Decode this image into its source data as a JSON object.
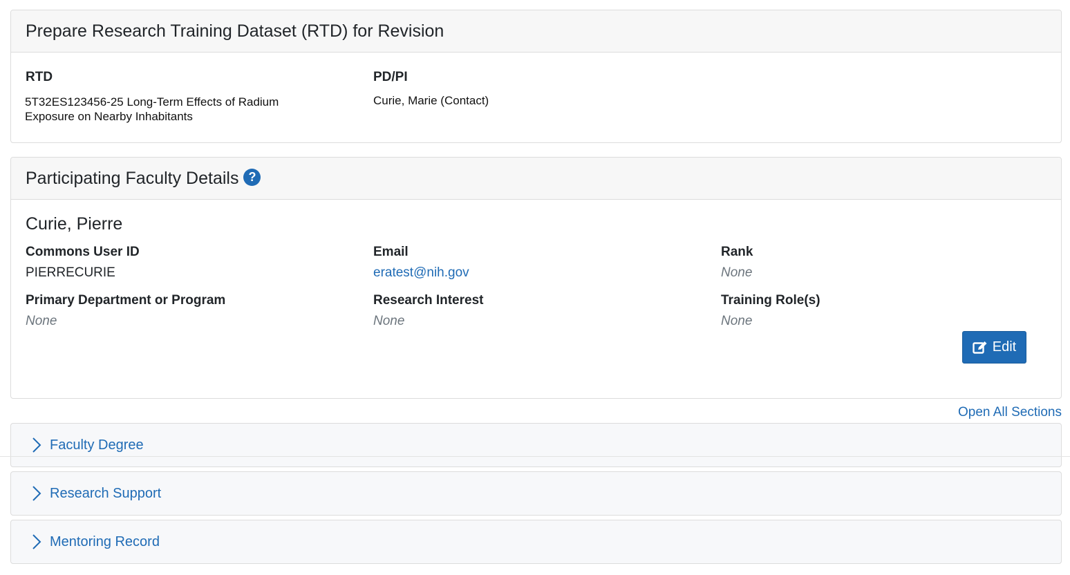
{
  "rtd_panel": {
    "title": "Prepare Research Training Dataset (RTD) for Revision",
    "rtd_label": "RTD",
    "rtd_value_line1": "5T32ES123456-25 Long-Term Effects of Radium",
    "rtd_value_line2": "Exposure on Nearby Inhabitants",
    "pdpi_label": "PD/PI",
    "pdpi_value": "Curie, Marie (Contact)"
  },
  "faculty_panel": {
    "title": "Participating Faculty Details",
    "help_icon": "question-circle-icon",
    "name": "Curie, Pierre",
    "fields": {
      "commons_label": "Commons User ID",
      "commons_value": "PIERRECURIE",
      "email_label": "Email",
      "email_value": "eratest@nih.gov",
      "rank_label": "Rank",
      "rank_value": "None",
      "dept_label": "Primary Department or Program",
      "dept_value": "None",
      "interest_label": "Research Interest",
      "interest_value": "None",
      "role_label": "Training Role(s)",
      "role_value": "None"
    },
    "edit_label": "Edit",
    "edit_icon": "edit-square-icon"
  },
  "open_all": "Open All Sections",
  "sections": {
    "degree": "Faculty Degree",
    "support": "Research Support",
    "mentoring": "Mentoring Record"
  },
  "colors": {
    "accent": "#1f6bb5",
    "header_bg": "#f7f7f7",
    "muted": "#6c757d"
  }
}
